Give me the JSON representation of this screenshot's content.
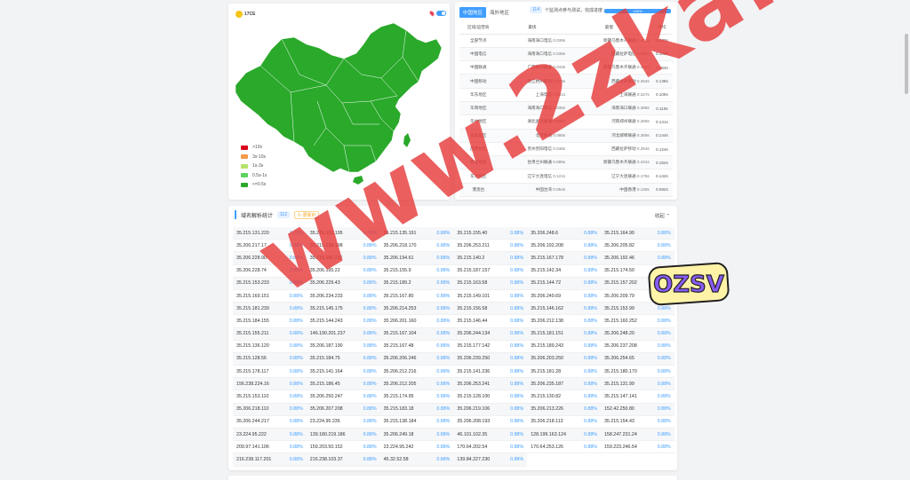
{
  "map": {
    "logo_text": "17CE",
    "legend": [
      {
        "label": ">10s",
        "color": "#d9001b"
      },
      {
        "label": "3s-10s",
        "color": "#f2994a"
      },
      {
        "label": "1s-3s",
        "color": "#b7e36b"
      },
      {
        "label": "0.5s-1s",
        "color": "#5fd35f"
      },
      {
        "label": "<=0.5s",
        "color": "#2aa92a"
      }
    ],
    "fill_color": "#2aa92a"
  },
  "region_panel": {
    "tabs": [
      {
        "label": "中国地区",
        "active": true
      },
      {
        "label": "海外地区",
        "active": false
      }
    ],
    "count": "114",
    "info": "个监测点参与测试，完成进度：",
    "progress_label": "100%",
    "progress": 100,
    "headers": [
      "区域/运营商",
      "最快",
      "最慢",
      "平均"
    ],
    "rows": [
      {
        "region": "全部节点",
        "best": "海南海口电信",
        "best_time": "0.036s",
        "worst": "新疆乌鲁木齐联通",
        "worst_time": "0.431s",
        "avg": "0.130s"
      },
      {
        "region": "中国电信",
        "best": "海南海口电信",
        "best_time": "0.036s",
        "worst": "西藏拉萨电信",
        "worst_time": "0.150s",
        "avg": "0.100s"
      },
      {
        "region": "中国联通",
        "best": "广西柳州联通",
        "best_time": "0.043s",
        "worst": "新疆乌鲁木齐联通",
        "worst_time": "0.431s",
        "avg": "0.154s"
      },
      {
        "region": "中国移动",
        "best": "浙江杭州移动",
        "best_time": "0.076s",
        "worst": "西藏拉萨移动",
        "worst_time": "0.254s",
        "avg": "0.138s"
      },
      {
        "region": "华东地区",
        "best": "上海电信",
        "best_time": "0.061s",
        "worst": "上海联通",
        "worst_time": "0.347s",
        "avg": "0.109s"
      },
      {
        "region": "华南地区",
        "best": "海南海口电信",
        "best_time": "0.036s",
        "worst": "海南海口联通",
        "worst_time": "0.386s",
        "avg": "0.110s"
      },
      {
        "region": "华中地区",
        "best": "湖北武汉联通",
        "best_time": "0.060s",
        "worst": "河南郑州联通",
        "worst_time": "0.266s",
        "avg": "0.141s"
      },
      {
        "region": "华北地区",
        "best": "北京联通",
        "best_time": "0.088s",
        "worst": "河北邯郸联通",
        "worst_time": "0.369s",
        "avg": "0.144s"
      },
      {
        "region": "西南地区",
        "best": "贵州贵阳电信",
        "best_time": "0.048s",
        "worst": "西藏拉萨移动",
        "worst_time": "0.254s",
        "avg": "0.124s"
      },
      {
        "region": "西北地区",
        "best": "甘肃兰州联通",
        "best_time": "0.085s",
        "worst": "新疆乌鲁木齐联通",
        "worst_time": "0.431s",
        "avg": "0.152s"
      },
      {
        "region": "东北地区",
        "best": "辽宁大连电信",
        "best_time": "0.121s",
        "worst": "辽宁大连联通",
        "worst_time": "0.175s",
        "avg": "0.142s"
      },
      {
        "region": "港澳台",
        "best": "中国台湾",
        "best_time": "0.054s",
        "worst": "中国香港",
        "worst_time": "0.130s",
        "avg": "0.092s"
      }
    ]
  },
  "dns_panel": {
    "title": "域名解析统计",
    "count": "112",
    "update_label": "更新IP",
    "collapse_label": "收起",
    "items": [
      {
        "ip": "35.215.131.220",
        "pct": "1.75%"
      },
      {
        "ip": "35.215.152.195",
        "pct": "1.75%"
      },
      {
        "ip": "35.215.135.191",
        "pct": "0.88%"
      },
      {
        "ip": "35.215.155.40",
        "pct": "0.88%"
      },
      {
        "ip": "35.206.248.6",
        "pct": "0.88%"
      },
      {
        "ip": "35.215.164.90",
        "pct": "0.88%"
      },
      {
        "ip": "35.206.217.17",
        "pct": "0.88%"
      },
      {
        "ip": "35.215.138.198",
        "pct": "0.88%"
      },
      {
        "ip": "35.206.218.170",
        "pct": "0.88%"
      },
      {
        "ip": "35.206.253.211",
        "pct": "0.88%"
      },
      {
        "ip": "35.206.192.208",
        "pct": "0.88%"
      },
      {
        "ip": "35.206.205.82",
        "pct": "0.88%"
      },
      {
        "ip": "35.206.228.90",
        "pct": "0.88%"
      },
      {
        "ip": "35.215.191.231",
        "pct": "0.88%"
      },
      {
        "ip": "35.206.194.61",
        "pct": "0.88%"
      },
      {
        "ip": "35.215.140.2",
        "pct": "0.88%"
      },
      {
        "ip": "35.215.167.178",
        "pct": "0.88%"
      },
      {
        "ip": "35.206.192.46",
        "pct": "0.88%"
      },
      {
        "ip": "35.206.228.74",
        "pct": "0.88%"
      },
      {
        "ip": "35.206.195.22",
        "pct": "0.88%"
      },
      {
        "ip": "35.215.155.9",
        "pct": "0.88%"
      },
      {
        "ip": "35.215.187.157",
        "pct": "0.88%"
      },
      {
        "ip": "35.215.142.34",
        "pct": "0.88%"
      },
      {
        "ip": "35.215.174.50",
        "pct": "0.88%"
      },
      {
        "ip": "35.215.153.233",
        "pct": "0.88%"
      },
      {
        "ip": "35.206.229.43",
        "pct": "0.88%"
      },
      {
        "ip": "35.215.189.2",
        "pct": "0.88%"
      },
      {
        "ip": "35.215.163.58",
        "pct": "0.88%"
      },
      {
        "ip": "35.215.144.72",
        "pct": "0.88%"
      },
      {
        "ip": "35.215.157.202",
        "pct": "0.88%"
      },
      {
        "ip": "35.215.169.151",
        "pct": "0.88%"
      },
      {
        "ip": "35.206.234.233",
        "pct": "0.88%"
      },
      {
        "ip": "35.215.167.80",
        "pct": "0.88%"
      },
      {
        "ip": "35.215.149.101",
        "pct": "0.88%"
      },
      {
        "ip": "35.206.240.69",
        "pct": "0.88%"
      },
      {
        "ip": "35.206.209.79",
        "pct": "0.88%"
      },
      {
        "ip": "35.215.181.239",
        "pct": "0.88%"
      },
      {
        "ip": "35.215.145.175",
        "pct": "0.88%"
      },
      {
        "ip": "35.206.214.253",
        "pct": "0.88%"
      },
      {
        "ip": "35.215.156.58",
        "pct": "0.88%"
      },
      {
        "ip": "35.215.146.162",
        "pct": "0.88%"
      },
      {
        "ip": "35.215.153.99",
        "pct": "0.88%"
      },
      {
        "ip": "35.215.184.155",
        "pct": "0.88%"
      },
      {
        "ip": "35.215.144.243",
        "pct": "0.88%"
      },
      {
        "ip": "35.206.201.160",
        "pct": "0.88%"
      },
      {
        "ip": "35.215.146.44",
        "pct": "0.88%"
      },
      {
        "ip": "35.206.212.138",
        "pct": "0.88%"
      },
      {
        "ip": "35.215.160.252",
        "pct": "0.88%"
      },
      {
        "ip": "35.215.155.211",
        "pct": "0.88%"
      },
      {
        "ip": "146.190.201.237",
        "pct": "0.88%"
      },
      {
        "ip": "35.215.167.104",
        "pct": "0.88%"
      },
      {
        "ip": "35.206.244.134",
        "pct": "0.88%"
      },
      {
        "ip": "35.215.181.151",
        "pct": "0.88%"
      },
      {
        "ip": "35.206.248.20",
        "pct": "0.88%"
      },
      {
        "ip": "35.215.136.120",
        "pct": "0.88%"
      },
      {
        "ip": "35.206.187.190",
        "pct": "0.88%"
      },
      {
        "ip": "35.215.167.48",
        "pct": "0.88%"
      },
      {
        "ip": "35.215.177.142",
        "pct": "0.88%"
      },
      {
        "ip": "35.215.189.243",
        "pct": "0.88%"
      },
      {
        "ip": "35.206.237.208",
        "pct": "0.88%"
      },
      {
        "ip": "35.215.128.56",
        "pct": "0.88%"
      },
      {
        "ip": "35.215.184.75",
        "pct": "0.88%"
      },
      {
        "ip": "35.206.206.246",
        "pct": "0.88%"
      },
      {
        "ip": "35.206.239.250",
        "pct": "0.88%"
      },
      {
        "ip": "35.206.203.250",
        "pct": "0.88%"
      },
      {
        "ip": "35.206.254.65",
        "pct": "0.88%"
      },
      {
        "ip": "35.215.178.117",
        "pct": "0.88%"
      },
      {
        "ip": "35.215.141.164",
        "pct": "0.88%"
      },
      {
        "ip": "35.206.212.216",
        "pct": "0.88%"
      },
      {
        "ip": "35.215.141.236",
        "pct": "0.88%"
      },
      {
        "ip": "35.215.181.28",
        "pct": "0.88%"
      },
      {
        "ip": "35.215.180.170",
        "pct": "0.88%"
      },
      {
        "ip": "156.238.224.16",
        "pct": "0.88%"
      },
      {
        "ip": "35.215.186.45",
        "pct": "0.88%"
      },
      {
        "ip": "35.206.212.205",
        "pct": "0.88%"
      },
      {
        "ip": "35.206.253.241",
        "pct": "0.88%"
      },
      {
        "ip": "35.206.235.187",
        "pct": "0.88%"
      },
      {
        "ip": "35.215.131.99",
        "pct": "0.88%"
      },
      {
        "ip": "35.215.153.110",
        "pct": "0.88%"
      },
      {
        "ip": "35.206.250.247",
        "pct": "0.88%"
      },
      {
        "ip": "35.215.174.95",
        "pct": "0.88%"
      },
      {
        "ip": "35.215.128.100",
        "pct": "0.88%"
      },
      {
        "ip": "35.215.130.82",
        "pct": "0.88%"
      },
      {
        "ip": "35.215.147.141",
        "pct": "0.88%"
      },
      {
        "ip": "35.206.218.110",
        "pct": "0.88%"
      },
      {
        "ip": "35.206.207.208",
        "pct": "0.88%"
      },
      {
        "ip": "35.215.183.18",
        "pct": "0.88%"
      },
      {
        "ip": "35.206.219.106",
        "pct": "0.88%"
      },
      {
        "ip": "35.206.213.226",
        "pct": "0.88%"
      },
      {
        "ip": "152.42.250.80",
        "pct": "0.88%"
      },
      {
        "ip": "35.206.244.217",
        "pct": "0.88%"
      },
      {
        "ip": "23.224.95.236",
        "pct": "0.88%"
      },
      {
        "ip": "35.215.138.184",
        "pct": "0.88%"
      },
      {
        "ip": "35.206.208.193",
        "pct": "0.88%"
      },
      {
        "ip": "35.206.218.113",
        "pct": "0.88%"
      },
      {
        "ip": "35.215.154.43",
        "pct": "0.88%"
      },
      {
        "ip": "23.224.95.222",
        "pct": "0.88%"
      },
      {
        "ip": "139.180.219.186",
        "pct": "0.88%"
      },
      {
        "ip": "35.206.249.18",
        "pct": "0.88%"
      },
      {
        "ip": "46.101.102.35",
        "pct": "0.88%"
      },
      {
        "ip": "128.199.163.124",
        "pct": "0.88%"
      },
      {
        "ip": "158.247.231.24",
        "pct": "0.88%"
      },
      {
        "ip": "209.97.141.106",
        "pct": "0.88%"
      },
      {
        "ip": "159.203.50.152",
        "pct": "0.88%"
      },
      {
        "ip": "23.224.95.242",
        "pct": "0.88%"
      },
      {
        "ip": "170.64.202.54",
        "pct": "0.88%"
      },
      {
        "ip": "170.64.253.126",
        "pct": "0.88%"
      },
      {
        "ip": "159.223.246.54",
        "pct": "0.88%"
      },
      {
        "ip": "216.238.117.201",
        "pct": "0.88%"
      },
      {
        "ip": "216.238.103.37",
        "pct": "0.88%"
      },
      {
        "ip": "45.32.52.58",
        "pct": "0.88%"
      },
      {
        "ip": "139.84.227.230",
        "pct": "0.88%"
      }
    ]
  },
  "watermark": {
    "text": "www.2zka.com",
    "badge": "OZSV",
    "color": "#e63c3c"
  }
}
